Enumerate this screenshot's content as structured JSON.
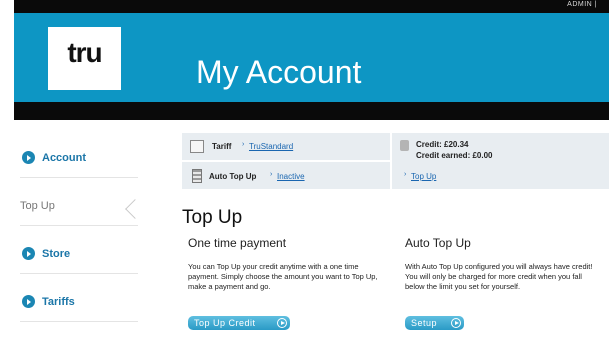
{
  "header": {
    "admin_link": "ADMIN |",
    "logo_text": "tru",
    "title": "My Account"
  },
  "sidebar": {
    "items": [
      {
        "label": "Account",
        "icon": "circle-arrow-icon",
        "active": false
      },
      {
        "label": "Top Up",
        "icon": "none",
        "active": true
      },
      {
        "label": "Store",
        "icon": "circle-arrow-icon",
        "active": false
      },
      {
        "label": "Tariffs",
        "icon": "circle-arrow-icon",
        "active": false
      }
    ]
  },
  "info": {
    "tariff_label": "Tariff",
    "tariff_value": "TruStandard",
    "auto_topup_label": "Auto Top Up",
    "auto_topup_value": "Inactive",
    "credit_label": "Credit: £20.34",
    "credit_earned_label": "Credit earned: £0.00",
    "topup_link": "Top Up",
    "bullet": "›"
  },
  "content": {
    "section_title": "Top Up",
    "one_time": {
      "title": "One time payment",
      "text": "You can Top Up your credit anytime with a one time payment. Simply choose the amount you want to Top Up, make a payment and go.",
      "button": "Top Up Credit"
    },
    "auto": {
      "title": "Auto Top Up",
      "text": "With Auto Top Up configured you will always have credit! You will only be charged for more credit when you fall below the limit you set for yourself.",
      "button": "Setup"
    }
  },
  "colors": {
    "brand_blue": "#0d96c4",
    "link_blue": "#1a66b0",
    "panel_grey": "#e8edf1"
  }
}
